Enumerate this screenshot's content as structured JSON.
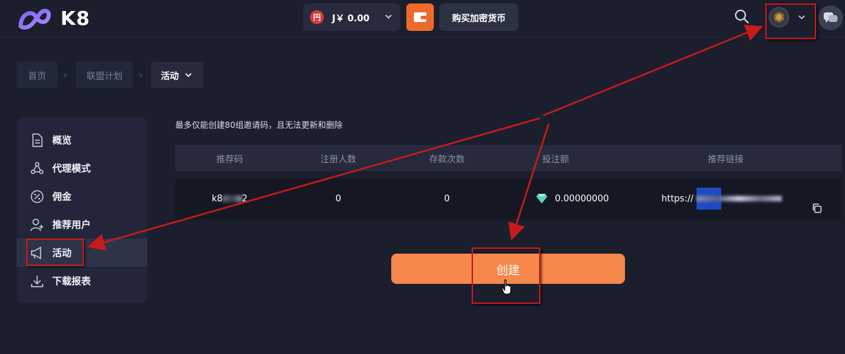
{
  "header": {
    "logo_text": "K8",
    "currency_badge": "円",
    "balance": "J￥ 0.00",
    "buy_crypto_label": "购买加密货币"
  },
  "breadcrumb": {
    "home": "首页",
    "affiliate": "联盟计划",
    "current": "活动"
  },
  "sidebar": {
    "items": [
      {
        "label": "概览",
        "icon": "document-icon"
      },
      {
        "label": "代理模式",
        "icon": "network-icon"
      },
      {
        "label": "佣金",
        "icon": "percent-icon"
      },
      {
        "label": "推荐用户",
        "icon": "user-add-icon"
      },
      {
        "label": "活动",
        "icon": "megaphone-icon",
        "active": true
      },
      {
        "label": "下载报表",
        "icon": "download-icon"
      }
    ]
  },
  "main": {
    "notice": "最多仅能创建80组邀请码，且无法更新和删除",
    "table": {
      "headers": [
        "推荐码",
        "注册人数",
        "存款次数",
        "投注额",
        "推荐链接"
      ],
      "rows": [
        {
          "code_prefix": "k8",
          "code_suffix": "2",
          "registrations": "0",
          "deposits": "0",
          "bet_amount": "0.00000000",
          "link_prefix": "https://"
        }
      ]
    },
    "create_label": "创建"
  },
  "colors": {
    "background": "#1b1e2d",
    "accent_orange": "#f5884a",
    "wallet_orange": "#ee6a2a",
    "annotation_red": "#c81a1a"
  }
}
